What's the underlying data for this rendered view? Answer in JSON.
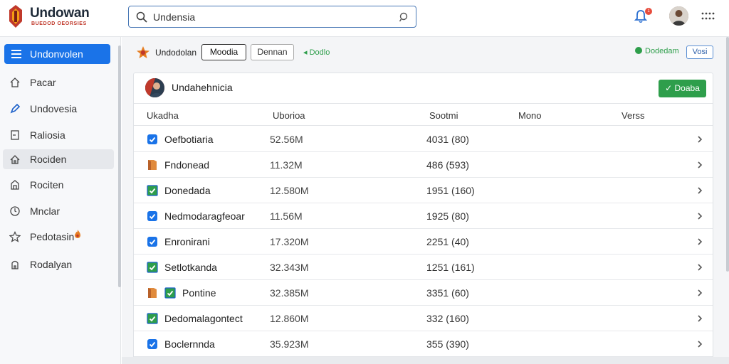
{
  "app": {
    "title": "Undowan",
    "subtitle": "BUEDOD OEORSIES"
  },
  "search": {
    "value": "Undensia"
  },
  "notifications": {
    "badge": "1"
  },
  "sidebar": {
    "active_label": "Undonvolen",
    "items": [
      {
        "label": "Pacar",
        "icon": "home-icon"
      },
      {
        "label": "Undovesia",
        "icon": "pen-icon"
      },
      {
        "label": "Raliosia",
        "icon": "door-icon"
      },
      {
        "label": "Rociden",
        "icon": "house-icon"
      },
      {
        "label": "Rociten",
        "icon": "building-icon"
      },
      {
        "label": "Mnclar",
        "icon": "clock-icon"
      },
      {
        "label": "Pedotasin",
        "icon": "star-icon"
      },
      {
        "label": "Rodalyan",
        "icon": "tower-icon"
      }
    ]
  },
  "toolbar": {
    "title": "Undodolan",
    "button_primary": "Moodia",
    "button_secondary": "Dennan",
    "link": "Dodlo",
    "status": "Dodedam",
    "button_small": "Vosi"
  },
  "panel": {
    "title": "Undahehnicia",
    "action_button": "Doaba"
  },
  "table": {
    "columns": [
      "Ukadha",
      "Uborioa",
      "Sootmi",
      "Mono",
      "Verss"
    ],
    "rows": [
      {
        "name": "Oefbotiaria",
        "size": "52.56M",
        "stat": "4031 (80)",
        "icon": "blue-check-icon",
        "extra_icon": ""
      },
      {
        "name": "Fndonead",
        "size": "11.32M",
        "stat": "486 (593)",
        "icon": "orange-folder-icon",
        "extra_icon": ""
      },
      {
        "name": "Donedada",
        "size": "12.580M",
        "stat": "1951 (160)",
        "icon": "green-check-icon",
        "extra_icon": ""
      },
      {
        "name": "Nedmodaragfeoar",
        "size": "11.56M",
        "stat": "1925 (80)",
        "icon": "blue-check-icon",
        "extra_icon": ""
      },
      {
        "name": "Enronirani",
        "size": "17.320M",
        "stat": "2251 (40)",
        "icon": "blue-check-icon",
        "extra_icon": ""
      },
      {
        "name": "Setlotkanda",
        "size": "32.343M",
        "stat": "1251 (161)",
        "icon": "green-check-icon",
        "extra_icon": ""
      },
      {
        "name": "Pontine",
        "size": "32.385M",
        "stat": "3351 (60)",
        "icon": "orange-folder-icon",
        "extra_icon": "green-check-icon"
      },
      {
        "name": "Dedomalagontect",
        "size": "12.860M",
        "stat": "332 (160)",
        "icon": "green-check-icon",
        "extra_icon": ""
      },
      {
        "name": "Boclernnda",
        "size": "35.923M",
        "stat": "355 (390)",
        "icon": "blue-check-icon",
        "extra_icon": ""
      }
    ]
  },
  "colors": {
    "accent": "#1a73e8",
    "success": "#2e9e4b",
    "brand_red": "#c0392b"
  }
}
